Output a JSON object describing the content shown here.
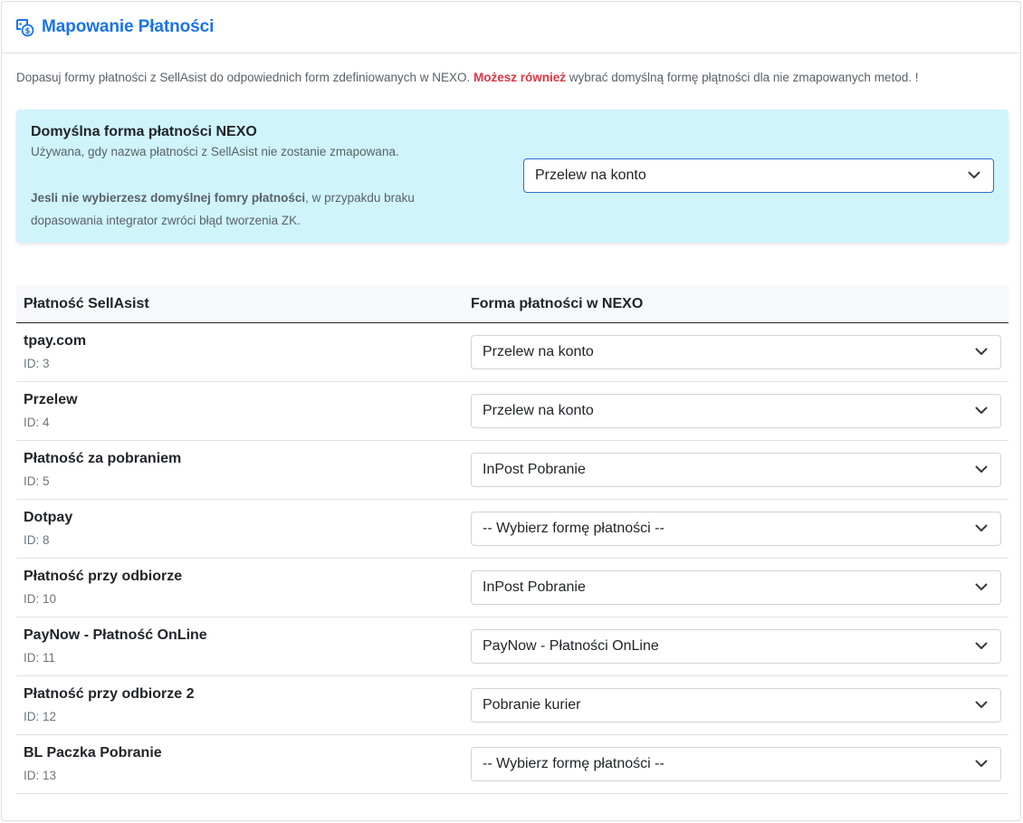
{
  "header": {
    "title": "Mapowanie Płatności",
    "icon": "payment-mapping-icon"
  },
  "intro": {
    "text_before": "Dopasuj formy płatności z SellAsist do odpowiednich form zdefiniowanych w NEXO.",
    "highlight": "Możesz również",
    "text_after": "wybrać domyślną formę płątności dla nie zmapowanych metod. !",
    "highlight_color": "#dc3545"
  },
  "default_box": {
    "title": "Domyślna forma płatności NEXO",
    "subtitle": "Używana, gdy nazwa płatności z SellAsist nie zostanie zmapowana.",
    "warning_bold": "Jesli nie wybierzesz domyślnej fomry płatności",
    "warning_rest": ", w przypakdu braku dopasowania integrator zwróci błąd tworzenia ZK.",
    "selected": "Przelew na konto",
    "background_color": "#cff4fc"
  },
  "table": {
    "col_sellasist": "Płatność SellAsist",
    "col_nexo": "Forma płatności w NEXO",
    "rows": [
      {
        "name": "tpay.com",
        "id": "ID: 3",
        "selected": "Przelew na konto"
      },
      {
        "name": "Przelew",
        "id": "ID: 4",
        "selected": "Przelew na konto"
      },
      {
        "name": "Płatność za pobraniem",
        "id": "ID: 5",
        "selected": "InPost Pobranie"
      },
      {
        "name": "Dotpay",
        "id": "ID: 8",
        "selected": "-- Wybierz formę płatności --"
      },
      {
        "name": "Płatność przy odbiorze",
        "id": "ID: 10",
        "selected": "InPost Pobranie"
      },
      {
        "name": "PayNow - Płatność OnLine",
        "id": "ID: 11",
        "selected": "PayNow - Płatności OnLine"
      },
      {
        "name": "Płatność przy odbiorze 2",
        "id": "ID: 12",
        "selected": "Pobranie kurier"
      },
      {
        "name": "BL Paczka Pobranie",
        "id": "ID: 13",
        "selected": "-- Wybierz formę płatności --"
      }
    ]
  },
  "colors": {
    "title_blue": "#1a73e8",
    "focus_border": "#2b6cd4"
  }
}
